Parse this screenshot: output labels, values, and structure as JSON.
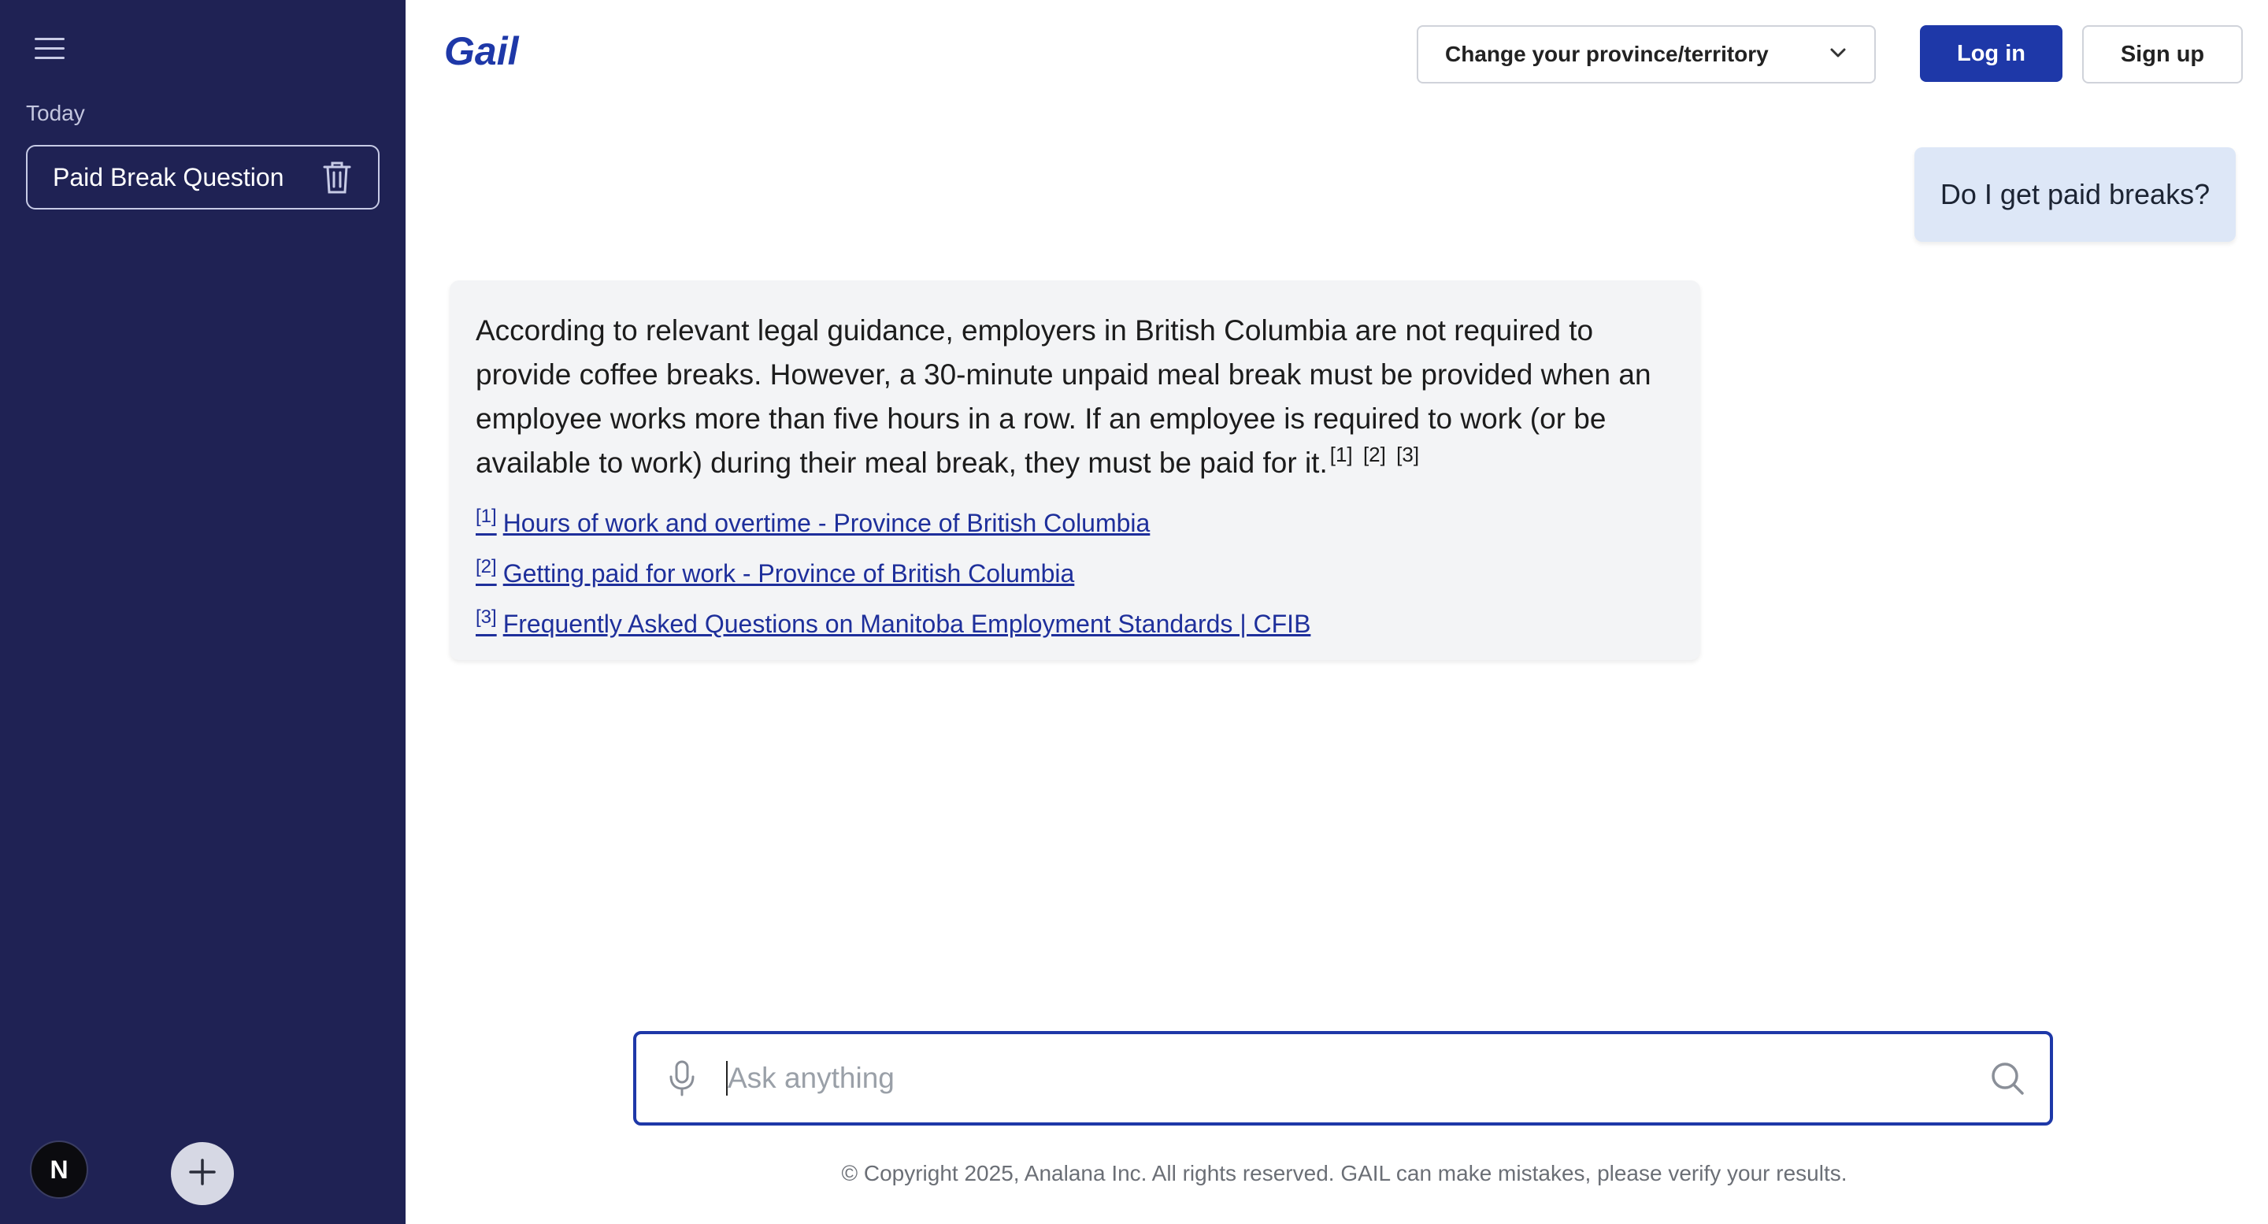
{
  "sidebar": {
    "section_label": "Today",
    "chats": [
      {
        "label": "Paid Break Question"
      }
    ],
    "avatar_letter": "N"
  },
  "header": {
    "logo": "Gail",
    "province_select": "Change your province/territory",
    "login_label": "Log in",
    "signup_label": "Sign up"
  },
  "conversation": {
    "user_message": "Do I get paid breaks?",
    "assistant_message": "According to relevant legal guidance, employers in British Columbia are not required to provide coffee breaks. However, a 30-minute unpaid meal break must be provided when an employee works more than five hours in a row. If an employee is required to work (or be available to work) during their meal break, they must be paid for it.",
    "citations": [
      "[1]",
      "[2]",
      "[3]"
    ],
    "sources": [
      {
        "ref": "[1]",
        "title": "Hours of work and overtime - Province of British Columbia"
      },
      {
        "ref": "[2]",
        "title": "Getting paid for work - Province of British Columbia"
      },
      {
        "ref": "[3]",
        "title": "Frequently Asked Questions on Manitoba Employment Standards | CFIB"
      }
    ]
  },
  "composer": {
    "placeholder": "Ask anything"
  },
  "footer": {
    "copyright": "© Copyright 2025, Analana Inc. All rights reserved. GAIL can make mistakes, please verify your results."
  },
  "colors": {
    "sidebar_bg": "#1f2254",
    "brand": "#1e38a8",
    "user_bubble": "#dde7f7",
    "assistant_bubble": "#f3f4f6"
  },
  "icons": [
    "menu-icon",
    "trash-icon",
    "plus-icon",
    "chevron-down-icon",
    "microphone-icon",
    "search-icon"
  ]
}
